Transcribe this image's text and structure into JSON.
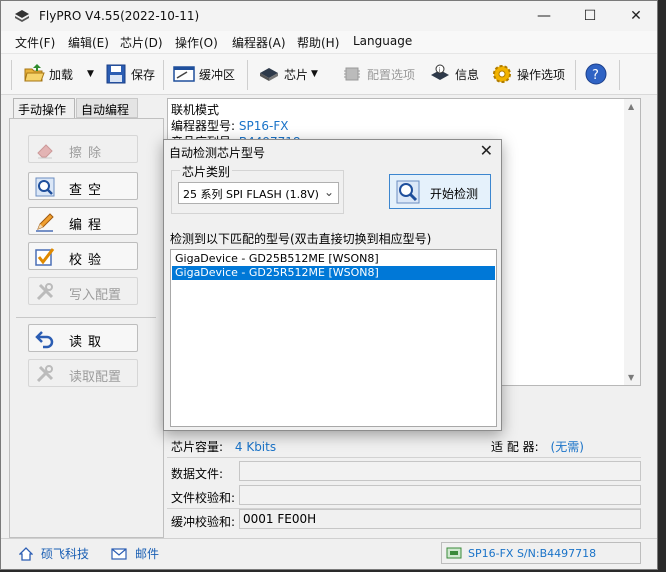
{
  "window": {
    "title": "FlyPRO V4.55(2022-10-11)"
  },
  "menu": [
    "文件(F)",
    "编辑(E)",
    "芯片(D)",
    "操作(O)",
    "编程器(A)",
    "帮助(H)",
    "Language"
  ],
  "toolbar": {
    "load": "加载",
    "save": "保存",
    "buffer": "缓冲区",
    "chip": "芯片",
    "config_options": "配置选项",
    "info": "信息",
    "op_options": "操作选项"
  },
  "left_tabs": [
    "手动操作",
    "自动编程"
  ],
  "ops": {
    "erase": "擦除",
    "blank": "查空",
    "program": "编程",
    "verify": "校验",
    "write_config": "写入配置",
    "read": "读取",
    "read_config": "读取配置"
  },
  "log": {
    "mode": "联机模式",
    "programmer_label": "编程器型号:",
    "programmer_value": "SP16-FX",
    "serial_label": "产品序列号:",
    "serial_value": "B4497718"
  },
  "info": {
    "capacity_label": "芯片容量:",
    "capacity_value": "4 Kbits",
    "adapter_label": "适 配 器:",
    "adapter_value": "(无需)",
    "data_file_label": "数据文件:",
    "data_file_value": "",
    "file_checksum_label": "文件校验和:",
    "file_checksum_value": "",
    "buffer_checksum_label": "缓冲校验和:",
    "buffer_checksum_value": "0001 FE00H"
  },
  "status": {
    "company": "硕飞科技",
    "mail": "邮件",
    "device": "SP16-FX  S/N:B4497718"
  },
  "dialog": {
    "title": "自动检测芯片型号",
    "group_label": "芯片类别",
    "select_value": "25 系列 SPI FLASH (1.8V)",
    "start_button": "开始检测",
    "result_label": "检测到以下匹配的型号(双击直接切换到相应型号)",
    "results": [
      "GigaDevice - GD25B512ME [WSON8]",
      "GigaDevice - GD25R512ME [WSON8]"
    ],
    "selected_index": 1
  },
  "colors": {
    "accent": "#0078d7",
    "value_blue": "#1a73c8"
  }
}
